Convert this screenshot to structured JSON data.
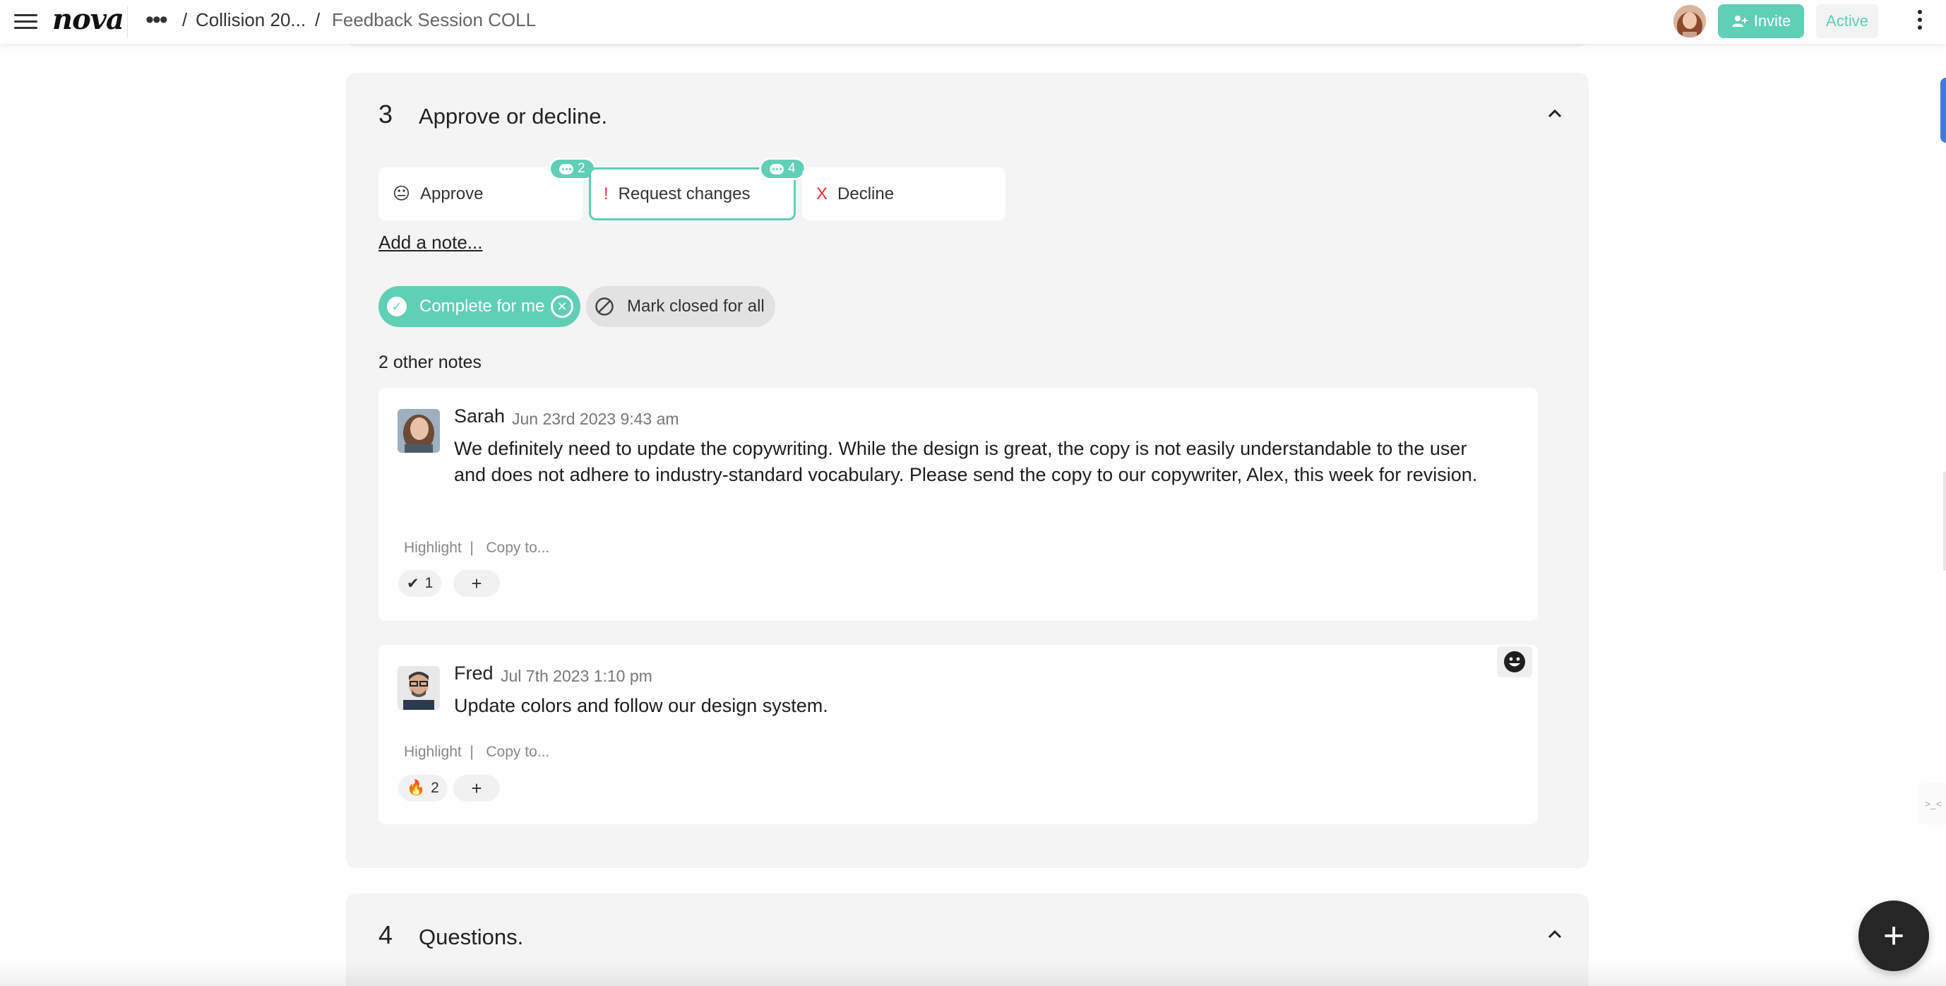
{
  "topbar": {
    "logo": "nova",
    "breadcrumbs": [
      "Collision 20...",
      "Feedback Session COLL"
    ],
    "invite_label": "Invite",
    "status_label": "Active",
    "accent_color": "#5fcfb6"
  },
  "section3": {
    "number": "3",
    "title": "Approve or decline.",
    "options": [
      {
        "label": "Approve",
        "icon": "😐",
        "count": "2"
      },
      {
        "label": "Request changes",
        "icon": "!",
        "count": "4",
        "selected": true
      },
      {
        "label": "Decline",
        "icon": "X"
      }
    ],
    "add_note_label": "Add a note...",
    "complete_label": "Complete for me",
    "mark_closed_label": "Mark closed for all",
    "other_notes_label": "2 other notes",
    "notes": [
      {
        "author": "Sarah",
        "time": "Jun 23rd 2023 9:43 am",
        "body": "We definitely need to update the copywriting. While the design is great, the copy is not easily understandable to the user and does not adhere to industry-standard vocabulary. Please send the copy to our copywriter, Alex, this week for revision.",
        "highlight_label": "Highlight",
        "separator": "|",
        "copy_label": "Copy to...",
        "reaction_emoji": "✔",
        "reaction_count": "1",
        "add_reaction_label": "+"
      },
      {
        "author": "Fred",
        "time": "Jul 7th 2023 1:10 pm",
        "body": "Update colors and follow our design system.",
        "highlight_label": "Highlight",
        "separator": "|",
        "copy_label": "Copy to...",
        "reaction_emoji": "🔥",
        "reaction_count": "2",
        "add_reaction_label": "+"
      }
    ]
  },
  "section4": {
    "number": "4",
    "title": "Questions."
  },
  "fab_label": "+",
  "side_tab_label": ">_<"
}
